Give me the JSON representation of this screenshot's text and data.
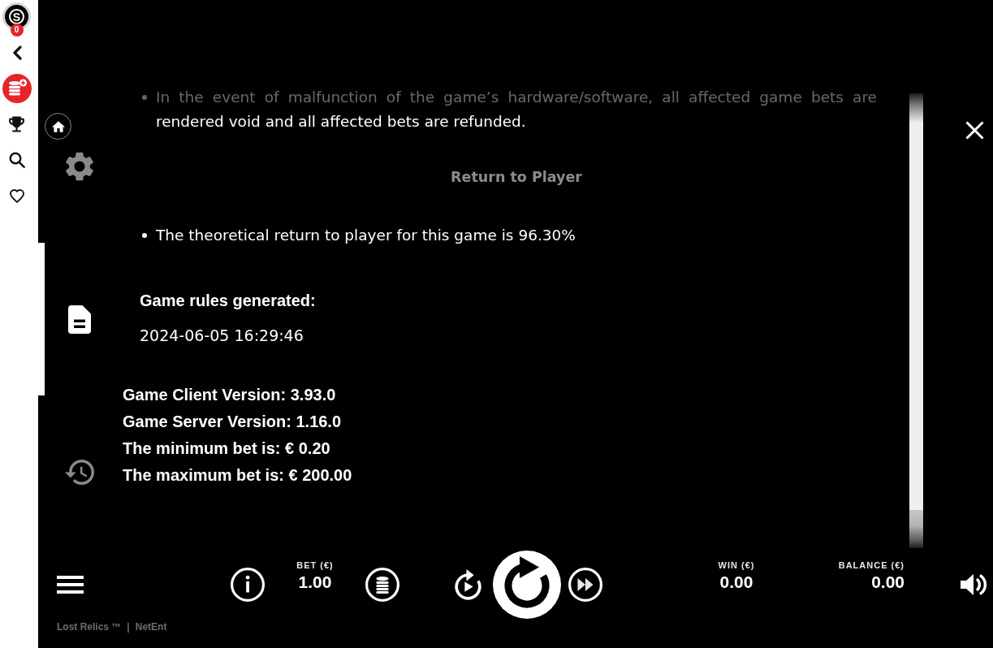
{
  "sidebar": {
    "logo_letter": "S",
    "notification_count": "0"
  },
  "menu": {
    "items": [
      {
        "kind": "settings",
        "selected": false
      },
      {
        "kind": "rules",
        "selected": true
      },
      {
        "kind": "history",
        "selected": false
      }
    ]
  },
  "rules": {
    "blocks": [
      {
        "kind": "bullet",
        "text": "In the event of malfunction of the game’s hardware/software, all affected game bets are rendered void and all affected bets are refunded."
      },
      {
        "kind": "heading",
        "text": "Return to Player"
      },
      {
        "kind": "bullet",
        "text": "The theoretical return to player for this game is 96.30%"
      },
      {
        "kind": "label",
        "text": "Game rules generated:"
      },
      {
        "kind": "timestamp",
        "text": "2024-06-05 16:29:46"
      },
      {
        "kind": "info",
        "text": "Game Client Version: 3.93.0"
      },
      {
        "kind": "info",
        "text": "Game Server Version: 1.16.0"
      },
      {
        "kind": "info",
        "text": "The minimum bet is: € 0.20"
      },
      {
        "kind": "info",
        "text": "The maximum bet is: € 200.00"
      }
    ]
  },
  "bottom_bar": {
    "bet": {
      "label": "BET (€)",
      "value": "1.00"
    },
    "win": {
      "label": "WIN (€)",
      "value": "0.00"
    },
    "balance": {
      "label": "BALANCE (€)",
      "value": "0.00"
    }
  },
  "footer": {
    "game": "Lost Relics ™",
    "separator": "|",
    "provider": "NetEnt"
  }
}
